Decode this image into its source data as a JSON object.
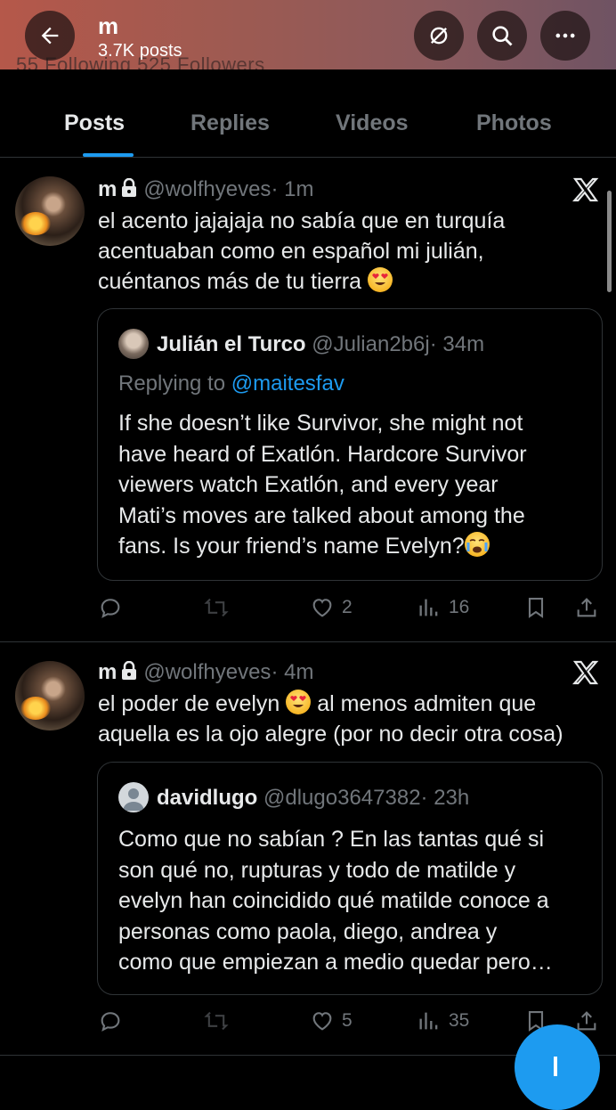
{
  "header": {
    "title": "m",
    "post_count": "3.7K posts",
    "ghost_stats": "55 Following   525 Followers"
  },
  "tabs": [
    {
      "label": "Posts",
      "active": true
    },
    {
      "label": "Replies",
      "active": false
    },
    {
      "label": "Videos",
      "active": false
    },
    {
      "label": "Photos",
      "active": false
    }
  ],
  "posts": [
    {
      "name": "m",
      "handle": "@wolfhyeves",
      "time": "· 1m",
      "lines": [
        "el acento jajajaja no sabía que en turquía",
        "acentuaban como en español mi julián,",
        "cuéntanos más de tu tierra"
      ],
      "quote": {
        "name": "Julián el Turco",
        "handle": "@Julian2b6j",
        "time": "· 34m",
        "replying_prefix": "Replying to",
        "replying_to": "@maitesfav",
        "lines": [
          "If she doesn’t like Survivor, she might not",
          "have heard of Exatlón. Hardcore Survivor",
          "viewers watch Exatlón, and every year",
          "Mati’s moves are talked about among the",
          "fans. Is your friend’s name Evelyn?"
        ]
      },
      "likes": "2",
      "views": "16"
    },
    {
      "name": "m",
      "handle": "@wolfhyeves",
      "time": "· 4m",
      "line1a": "el poder de evelyn",
      "line1b": "al menos admiten que",
      "line2": "aquella es la ojo alegre (por no decir otra cosa)",
      "quote": {
        "name": "davidlugo",
        "handle": "@dlugo3647382",
        "time": "· 23h",
        "lines": [
          "Como que no sabían ? En las tantas qué si",
          "son qué no, rupturas y todo de matilde y",
          "evelyn han coincidido qué matilde conoce a",
          "personas como paola, diego, andrea y",
          "como que empiezan a medio quedar pero…"
        ]
      },
      "likes": "5",
      "views": "35"
    }
  ],
  "colors": {
    "accent": "#1d9bf0",
    "muted": "#71767b",
    "border": "#2f3336",
    "background": "#000000"
  },
  "icons": [
    "back-arrow-icon",
    "grok-icon",
    "search-icon",
    "more-icon",
    "lock-icon",
    "x-logo-icon",
    "reply-icon",
    "retweet-icon",
    "like-icon",
    "views-icon",
    "bookmark-icon",
    "share-icon",
    "heart-eyes-emoji",
    "crying-emoji"
  ]
}
